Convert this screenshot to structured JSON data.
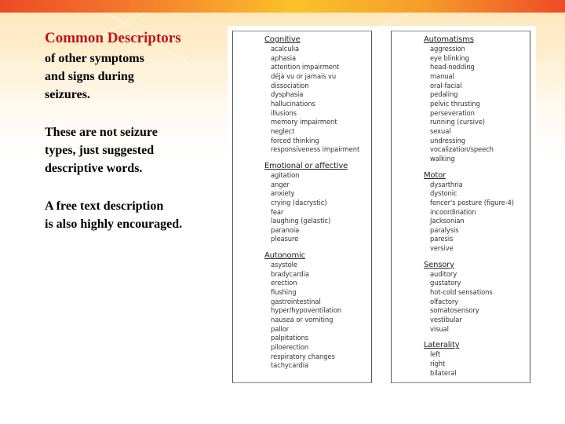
{
  "slide": {
    "title": "Common Descriptors",
    "paragraphs": [
      "of other symptoms\nand signs during\nseizures.",
      "These are not seizure\ntypes, just suggested\ndescriptive words.",
      "A free text description\nis also highly encouraged."
    ],
    "colors": {
      "title": "#c0121a",
      "top_bar_edges": "#ee4a26",
      "top_bar_center": "#fbc22a",
      "background_top": "#fde6b8"
    }
  },
  "descriptors": {
    "left_column": [
      {
        "heading": "Cognitive",
        "items": [
          "acalculia",
          "aphasia",
          "attention impairment",
          "déjà vu or jamais vu",
          "dissociation",
          "dysphasia",
          "hallucinations",
          "illusions",
          "memory impairment",
          "neglect",
          "forced thinking",
          "responsiveness impairment"
        ]
      },
      {
        "heading": "Emotional or affective",
        "items": [
          "agitation",
          "anger",
          "anxiety",
          "crying (dacrystic)",
          "fear",
          "laughing (gelastic)",
          "paranoia",
          "pleasure"
        ]
      },
      {
        "heading": "Autonomic",
        "items": [
          "asystole",
          "bradycardia",
          "erection",
          "flushing",
          "gastrointestinal",
          "hyper/hypoventilation",
          "nausea or vomiting",
          "pallor",
          "palpitations",
          "piloerection",
          "respiratory changes",
          "tachycardia"
        ]
      }
    ],
    "right_column": [
      {
        "heading": "Automatisms",
        "items": [
          "aggression",
          "eye blinking",
          "head-nodding",
          "manual",
          "oral-facial",
          "pedaling",
          "pelvic thrusting",
          "perseveration",
          "running (cursive)",
          "sexual",
          "undressing",
          "vocalization/speech",
          "walking"
        ]
      },
      {
        "heading": "Motor",
        "items": [
          "dysarthria",
          "dystonic",
          "fencer's posture (figure-4)",
          "incoordination",
          "Jacksonian",
          "paralysis",
          "paresis",
          "versive"
        ]
      },
      {
        "heading": "Sensory",
        "items": [
          "auditory",
          "gustatory",
          "hot-cold sensations",
          "olfactory",
          "somatosensory",
          "vestibular",
          "visual"
        ]
      },
      {
        "heading": "Laterality",
        "items": [
          "left",
          "right",
          "bilateral"
        ]
      }
    ]
  }
}
